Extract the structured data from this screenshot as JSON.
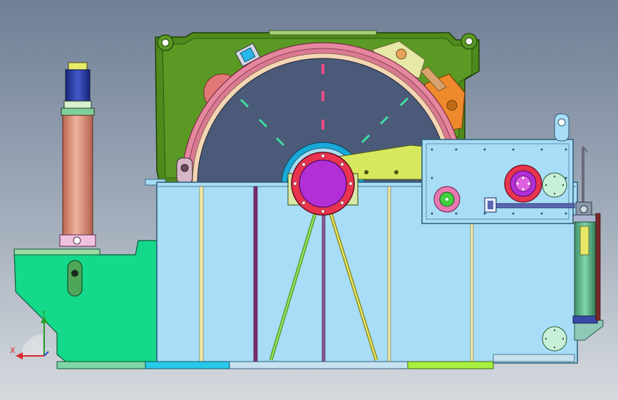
{
  "axis_triad": {
    "x_label": "X",
    "y_label": "Y"
  },
  "colors": {
    "background_top": "#6f7f96",
    "background_bottom": "#d6dadf",
    "frame_green": "#4f8a1c",
    "tank_blue": "#a8ddf7",
    "drum_dark": "#4b5a78",
    "drum_rim_pink": "#e5879f",
    "hub_red": "#e8344e",
    "hub_purple": "#b22fd6",
    "base_green": "#14d98a",
    "cylinder_copper": "#d98c76",
    "cylinder_navy": "#2a3c9e",
    "accent_yellow": "#e8ee6a",
    "accent_orange": "#ee8a2c",
    "light_green": "#a8e8b0"
  }
}
